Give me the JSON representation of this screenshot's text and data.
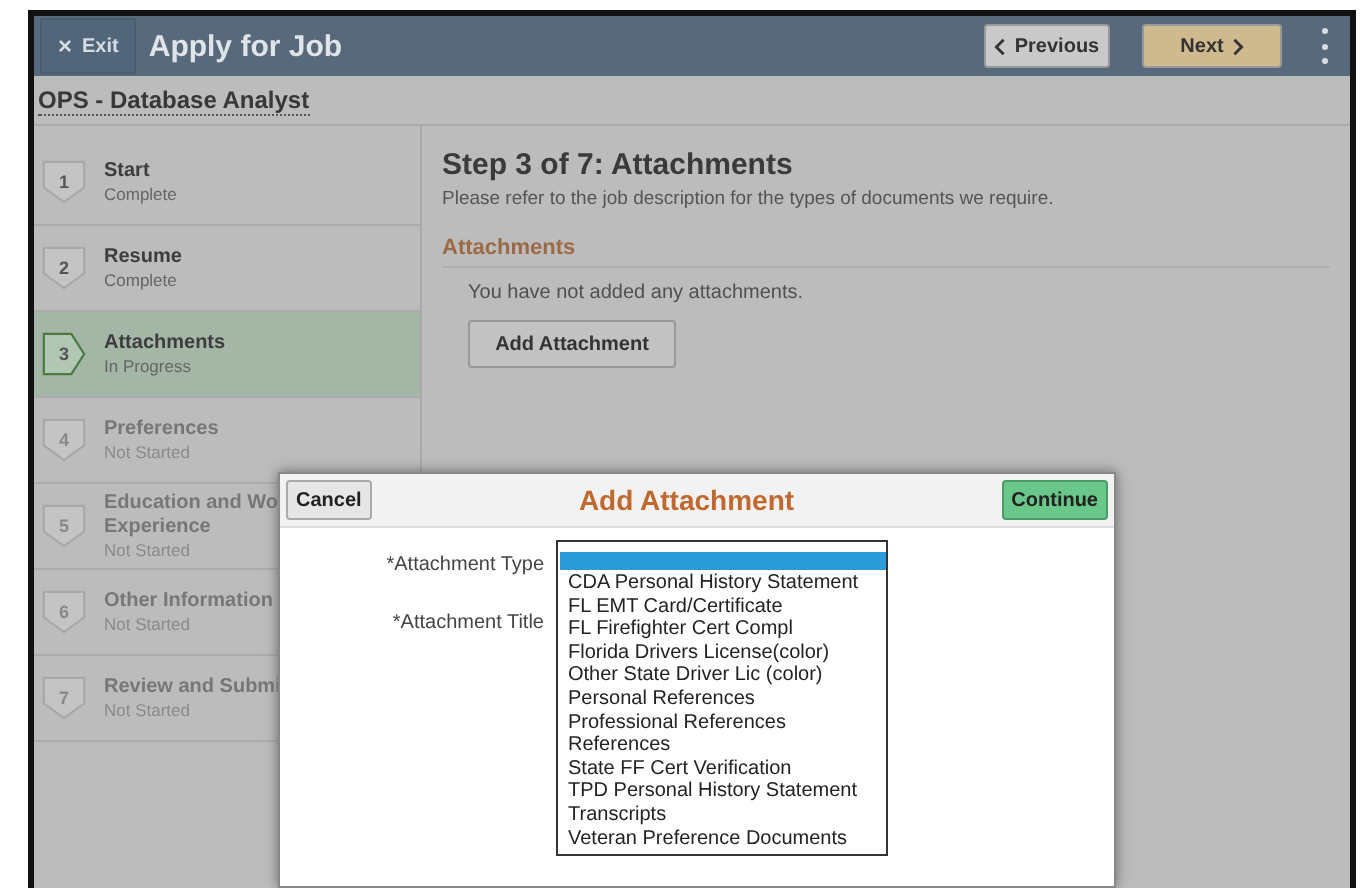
{
  "header": {
    "exit": {
      "icon": "×",
      "label": "Exit"
    },
    "title": "Apply for Job",
    "previous": "Previous",
    "next": "Next"
  },
  "job_title": "OPS - Database Analyst",
  "steps": [
    {
      "number": "1",
      "title": [
        "Start"
      ],
      "status": "Complete",
      "disabled": false,
      "selected": false
    },
    {
      "number": "2",
      "title": [
        "Resume"
      ],
      "status": "Complete",
      "disabled": false,
      "selected": false
    },
    {
      "number": "3",
      "title": [
        "Attachments"
      ],
      "status": "In Progress",
      "disabled": false,
      "selected": true
    },
    {
      "number": "4",
      "title": [
        "Preferences"
      ],
      "status": "Not Started",
      "disabled": true,
      "selected": false
    },
    {
      "number": "5",
      "title": [
        "Education and Wo",
        "Experience"
      ],
      "status": "Not Started",
      "disabled": true,
      "selected": false
    },
    {
      "number": "6",
      "title": [
        "Other Information"
      ],
      "status": "Not Started",
      "disabled": true,
      "selected": false
    },
    {
      "number": "7",
      "title": [
        "Review and Submi"
      ],
      "status": "Not Started",
      "disabled": true,
      "selected": false
    }
  ],
  "content": {
    "heading": "Step 3 of 7: Attachments",
    "description": "Please refer to the job description for the types of documents we require.",
    "section": "Attachments",
    "empty_message": "You have not added any attachments.",
    "add_button": "Add Attachment"
  },
  "dialog": {
    "cancel": "Cancel",
    "title": "Add Attachment",
    "continue": "Continue",
    "fields": [
      {
        "label": "*Attachment Type"
      },
      {
        "label": "*Attachment Title"
      }
    ],
    "listbox": {
      "blank_selected": true,
      "options": [
        {
          "label": "CDA Personal History Statement",
          "selected": false
        },
        {
          "label": "FL EMT Card/Certificate",
          "selected": false
        },
        {
          "label": "FL Firefighter Cert Compl",
          "selected": false
        },
        {
          "label": "Florida Drivers License(color)",
          "selected": false
        },
        {
          "label": "Other State Driver Lic (color)",
          "selected": false
        },
        {
          "label": "Personal References",
          "selected": false
        },
        {
          "label": "Professional References",
          "selected": false
        },
        {
          "label": "References",
          "selected": false
        },
        {
          "label": "State FF Cert Verification",
          "selected": false
        },
        {
          "label": "TPD Personal History Statement",
          "selected": false
        },
        {
          "label": "Transcripts",
          "selected": false
        },
        {
          "label": "Veteran Preference Documents",
          "selected": false
        }
      ]
    }
  }
}
